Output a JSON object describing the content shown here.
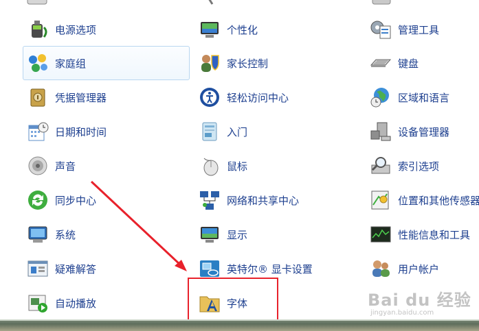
{
  "colors": {
    "link_text": "#1d3f8f",
    "highlight_box": "#e8212b",
    "arrow": "#e8212b",
    "hover_border": "#b8d6f0"
  },
  "columns": [
    {
      "items": [
        {
          "label": "电源选项",
          "icon": "power-options-icon"
        },
        {
          "label": "家庭组",
          "icon": "homegroup-icon",
          "hovered": true
        },
        {
          "label": "凭据管理器",
          "icon": "credential-manager-icon"
        },
        {
          "label": "日期和时间",
          "icon": "date-time-icon"
        },
        {
          "label": "声音",
          "icon": "sound-icon"
        },
        {
          "label": "同步中心",
          "icon": "sync-center-icon"
        },
        {
          "label": "系统",
          "icon": "system-icon"
        },
        {
          "label": "疑难解答",
          "icon": "troubleshooting-icon"
        },
        {
          "label": "自动播放",
          "icon": "autoplay-icon"
        }
      ]
    },
    {
      "items": [
        {
          "label": "个性化",
          "icon": "personalization-icon"
        },
        {
          "label": "家长控制",
          "icon": "parental-controls-icon"
        },
        {
          "label": "轻松访问中心",
          "icon": "ease-of-access-icon"
        },
        {
          "label": "入门",
          "icon": "getting-started-icon"
        },
        {
          "label": "鼠标",
          "icon": "mouse-icon"
        },
        {
          "label": "网络和共享中心",
          "icon": "network-sharing-icon"
        },
        {
          "label": "显示",
          "icon": "display-icon"
        },
        {
          "label": "英特尔® 显卡设置",
          "icon": "intel-graphics-icon"
        },
        {
          "label": "字体",
          "icon": "fonts-icon",
          "annotated": true
        }
      ]
    },
    {
      "items": [
        {
          "label": "管理工具",
          "icon": "admin-tools-icon"
        },
        {
          "label": "键盘",
          "icon": "keyboard-icon"
        },
        {
          "label": "区域和语言",
          "icon": "region-language-icon"
        },
        {
          "label": "设备管理器",
          "icon": "device-manager-icon"
        },
        {
          "label": "索引选项",
          "icon": "indexing-options-icon"
        },
        {
          "label": "位置和其他传感器",
          "icon": "location-sensors-icon"
        },
        {
          "label": "性能信息和工具",
          "icon": "performance-icon"
        },
        {
          "label": "用户帐户",
          "icon": "user-accounts-icon"
        }
      ]
    }
  ],
  "watermark": {
    "main": "Bai du 经验",
    "sub": "jingyan.baidu.com"
  }
}
